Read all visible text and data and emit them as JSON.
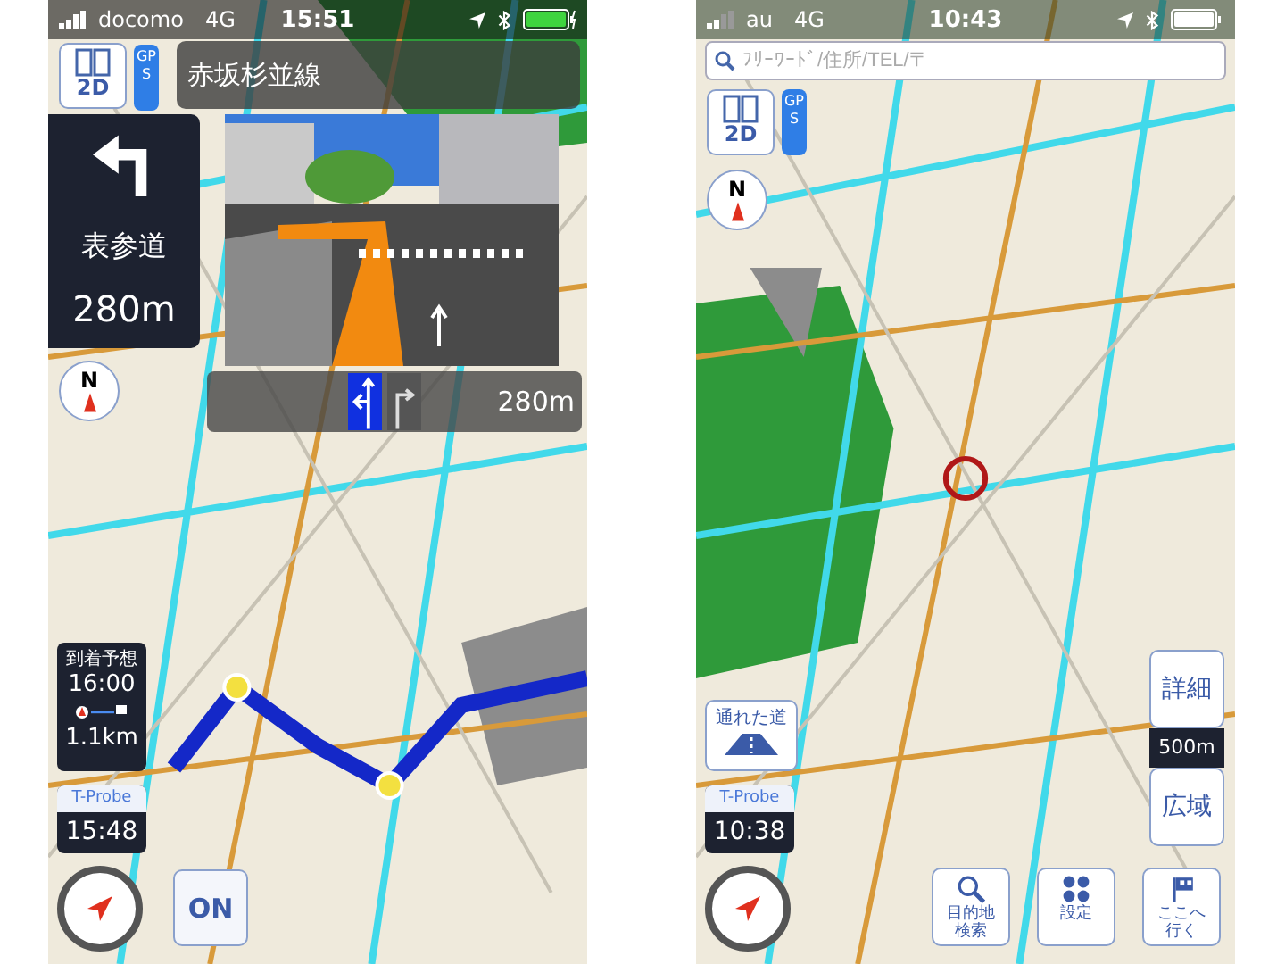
{
  "navigation_screen": {
    "status_bar": {
      "carrier": "docomo",
      "network": "4G",
      "time": "15:51",
      "battery_charging": true
    },
    "mode_button": "2D",
    "gps_badge": "GPS",
    "road_name": "赤坂杉並線",
    "turn": {
      "street": "表参道",
      "distance": "280m"
    },
    "lane_guide": {
      "lanes": [
        {
          "kind": "left-straight",
          "selected": true
        },
        {
          "kind": "right",
          "selected": false
        }
      ],
      "distance": "280m"
    },
    "compass": "N",
    "arrival": {
      "label": "到着予想",
      "time": "16:00",
      "distance": "1.1km"
    },
    "t_probe": {
      "label": "T-Probe",
      "time": "15:48"
    },
    "toggle": "ON"
  },
  "map_screen": {
    "status_bar": {
      "carrier": "au",
      "network": "4G",
      "time": "10:43",
      "battery_charging": false
    },
    "search": {
      "placeholder": "ﾌﾘｰﾜｰﾄﾞ/住所/TEL/〒"
    },
    "mode_button": "2D",
    "gps_badge": "GPS",
    "compass": "N",
    "passable_roads_button": "通れた道",
    "t_probe": {
      "label": "T-Probe",
      "time": "10:38"
    },
    "zoom": {
      "detail": "詳細",
      "scale": "500m",
      "wide": "広域"
    },
    "bottom_buttons": [
      {
        "kind": "search",
        "label": "目的地検索"
      },
      {
        "kind": "settings",
        "label": "設定"
      },
      {
        "kind": "goto",
        "label": "ここへ行く"
      }
    ]
  }
}
